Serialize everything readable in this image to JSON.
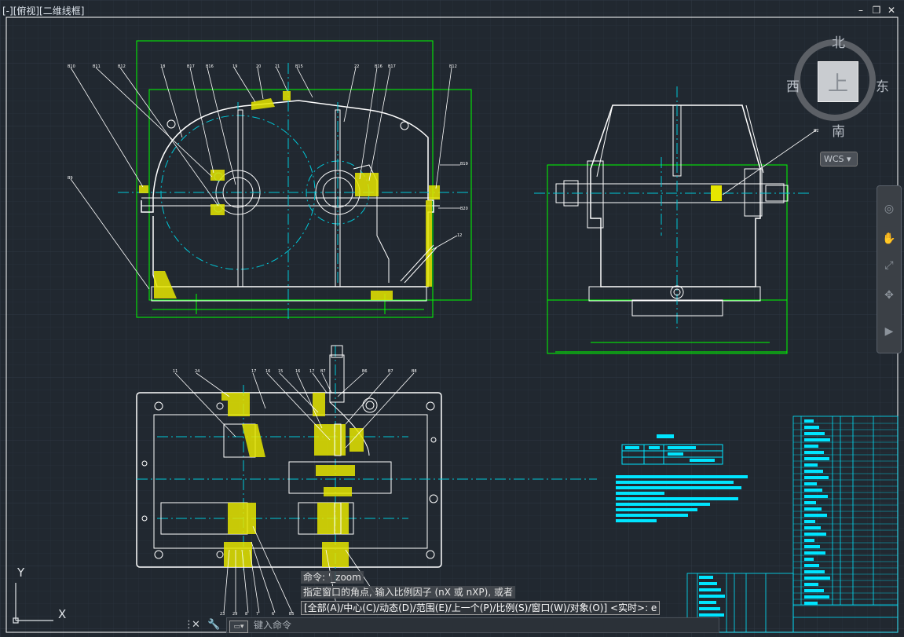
{
  "viewport": {
    "label": "[-][俯视][二维线框]"
  },
  "window_controls": {
    "minimize": "–",
    "restore": "❐",
    "close": "✕"
  },
  "viewcube": {
    "north": "北",
    "south": "南",
    "east": "东",
    "west": "西",
    "face": "上",
    "wcs": "WCS"
  },
  "navbar": {
    "icons": [
      "full-navigation-wheel-icon",
      "pan-icon",
      "zoom-icon",
      "orbit-icon",
      "showmotion-icon"
    ]
  },
  "command_history": [
    "命令: '_zoom",
    "指定窗口的角点, 输入比例因子 (nX 或 nXP), 或者"
  ],
  "command_prompt": "[全部(A)/中心(C)/动态(D)/范围(E)/上一个(P)/比例(S)/窗口(W)/对象(O)] <实时>:  e",
  "command_input": {
    "placeholder": "键入命令"
  },
  "ucs": {
    "x": "X",
    "y": "Y"
  },
  "colors": {
    "background": "#212830",
    "outline": "#ffffff",
    "centerline": "#00c8d8",
    "dimension": "#00ff00",
    "hatch": "#e6e600",
    "table": "#00e5ff",
    "grid": "#2c343d"
  }
}
